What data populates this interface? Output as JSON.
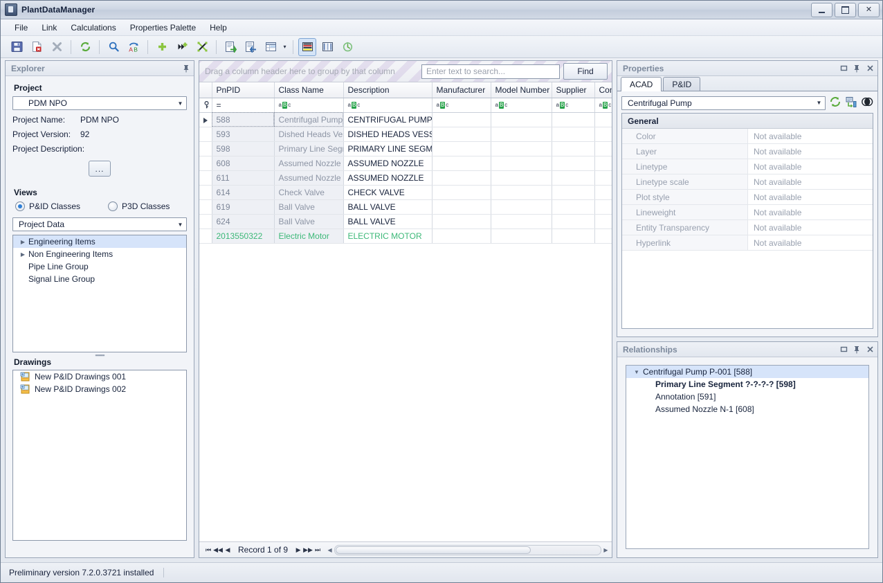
{
  "window": {
    "title": "PlantDataManager",
    "icon": "app-icon",
    "minimize": "Minimize",
    "maximize": "Maximize",
    "close": "✕"
  },
  "menu": {
    "items": [
      {
        "label": "File"
      },
      {
        "label": "Link"
      },
      {
        "label": "Calculations"
      },
      {
        "label": "Properties Palette"
      },
      {
        "label": "Help"
      }
    ]
  },
  "toolbar": {
    "buttons": [
      {
        "name": "save-icon",
        "title": "Save"
      },
      {
        "name": "delete-record-icon",
        "title": "Delete record"
      },
      {
        "name": "cancel-icon",
        "title": "Cancel"
      },
      {
        "name": "refresh-icon",
        "title": "Refresh"
      },
      {
        "name": "search-icon",
        "title": "Search"
      },
      {
        "name": "rename-icon",
        "title": "Rename"
      },
      {
        "name": "add-icon",
        "title": "Add"
      },
      {
        "name": "add-link-icon",
        "title": "Add link"
      },
      {
        "name": "unlink-icon",
        "title": "Unlink"
      },
      {
        "name": "export-icon",
        "title": "Export"
      },
      {
        "name": "import-icon",
        "title": "Import"
      },
      {
        "name": "table-layout-icon",
        "title": "Table layout"
      },
      {
        "name": "row-view-icon",
        "title": "Row view"
      },
      {
        "name": "column-view-icon",
        "title": "Column view"
      },
      {
        "name": "history-icon",
        "title": "History"
      }
    ]
  },
  "explorer": {
    "title": "Explorer",
    "pin": "pin-icon",
    "project_section_label": "Project",
    "project_combo_value": "PDM NPO",
    "fields": [
      {
        "label": "Project Name:",
        "value": "PDM NPO"
      },
      {
        "label": "Project Version:",
        "value": "92"
      },
      {
        "label": "Project Description:",
        "value": ""
      }
    ],
    "browse_button": "...",
    "views_section_label": "Views",
    "view_options": [
      {
        "label": "P&ID Classes",
        "selected": true
      },
      {
        "label": "P3D Classes",
        "selected": false
      }
    ],
    "data_combo_value": "Project Data",
    "tree_nodes": [
      {
        "label": "Engineering Items",
        "expandable": true,
        "selected": true
      },
      {
        "label": "Non Engineering Items",
        "expandable": true,
        "selected": false
      },
      {
        "label": "Pipe Line Group",
        "expandable": false,
        "selected": false
      },
      {
        "label": "Signal Line Group",
        "expandable": false,
        "selected": false
      }
    ],
    "drawings_section_label": "Drawings",
    "drawings": [
      {
        "label": "New P&ID Drawings 001"
      },
      {
        "label": "New P&ID Drawings 002"
      }
    ]
  },
  "grid": {
    "group_hint": "Drag a column header here to group by that column",
    "search_placeholder": "Enter text to search...",
    "search_value": "",
    "find_label": "Find",
    "columns": [
      "PnPID",
      "Class Name",
      "Description",
      "Manufacturer",
      "Model Number",
      "Supplier",
      "Commer"
    ],
    "filter_row": [
      "=",
      "abc",
      "abc",
      "abc",
      "abc",
      "abc",
      "abc"
    ],
    "rows": [
      {
        "pnpid": "588",
        "class_name": "Centrifugal Pump",
        "description": "CENTRIFUGAL PUMP",
        "manufacturer": "",
        "model_number": "",
        "supplier": "",
        "comment": "",
        "current": true,
        "green": false
      },
      {
        "pnpid": "593",
        "class_name": "Dished Heads Vessel",
        "description": "DISHED HEADS VESSEL",
        "manufacturer": "",
        "model_number": "",
        "supplier": "",
        "comment": "",
        "current": false,
        "green": false
      },
      {
        "pnpid": "598",
        "class_name": "Primary Line Segment",
        "description": "PRIMARY LINE SEGMENT",
        "manufacturer": "",
        "model_number": "",
        "supplier": "",
        "comment": "",
        "current": false,
        "green": false
      },
      {
        "pnpid": "608",
        "class_name": "Assumed Nozzle",
        "description": "ASSUMED NOZZLE",
        "manufacturer": "",
        "model_number": "",
        "supplier": "",
        "comment": "",
        "current": false,
        "green": false
      },
      {
        "pnpid": "611",
        "class_name": "Assumed Nozzle",
        "description": "ASSUMED NOZZLE",
        "manufacturer": "",
        "model_number": "",
        "supplier": "",
        "comment": "",
        "current": false,
        "green": false
      },
      {
        "pnpid": "614",
        "class_name": "Check Valve",
        "description": "CHECK VALVE",
        "manufacturer": "",
        "model_number": "",
        "supplier": "",
        "comment": "",
        "current": false,
        "green": false
      },
      {
        "pnpid": "619",
        "class_name": "Ball Valve",
        "description": "BALL VALVE",
        "manufacturer": "",
        "model_number": "",
        "supplier": "",
        "comment": "",
        "current": false,
        "green": false
      },
      {
        "pnpid": "624",
        "class_name": "Ball Valve",
        "description": "BALL VALVE",
        "manufacturer": "",
        "model_number": "",
        "supplier": "",
        "comment": "",
        "current": false,
        "green": false
      },
      {
        "pnpid": "2013550322",
        "class_name": "Electric Motor",
        "description": "ELECTRIC MOTOR",
        "manufacturer": "",
        "model_number": "",
        "supplier": "",
        "comment": "",
        "current": false,
        "green": true
      }
    ],
    "record_info": "Record 1 of 9",
    "colors": {
      "green_row": "#3cb878",
      "selection": "#d6e4fa"
    }
  },
  "properties": {
    "title": "Properties",
    "tabs": [
      {
        "label": "ACAD",
        "active": true
      },
      {
        "label": "P&ID",
        "active": false
      }
    ],
    "object_combo_value": "Centrifugal Pump",
    "tool_icons": [
      {
        "name": "refresh-properties-icon"
      },
      {
        "name": "select-objects-icon"
      },
      {
        "name": "quick-select-icon"
      }
    ],
    "category": "General",
    "rows": [
      {
        "name": "Color",
        "value": "Not available"
      },
      {
        "name": "Layer",
        "value": "Not available"
      },
      {
        "name": "Linetype",
        "value": "Not available"
      },
      {
        "name": "Linetype scale",
        "value": "Not available"
      },
      {
        "name": "Plot style",
        "value": "Not available"
      },
      {
        "name": "Lineweight",
        "value": "Not available"
      },
      {
        "name": "Entity Transparency",
        "value": "Not available"
      },
      {
        "name": "Hyperlink",
        "value": "Not available"
      }
    ]
  },
  "relationships": {
    "title": "Relationships",
    "nodes": [
      {
        "label": "Centrifugal Pump P-001 [588]",
        "level": 0,
        "selected": true,
        "bold": false,
        "expanded": true
      },
      {
        "label": "Primary Line Segment ?-?-?-? [598]",
        "level": 1,
        "selected": false,
        "bold": true,
        "expanded": false
      },
      {
        "label": "Annotation [591]",
        "level": 1,
        "selected": false,
        "bold": false,
        "expanded": false
      },
      {
        "label": "Assumed Nozzle N-1 [608]",
        "level": 1,
        "selected": false,
        "bold": false,
        "expanded": false
      }
    ]
  },
  "statusbar": {
    "text": "Preliminary version 7.2.0.3721 installed"
  }
}
